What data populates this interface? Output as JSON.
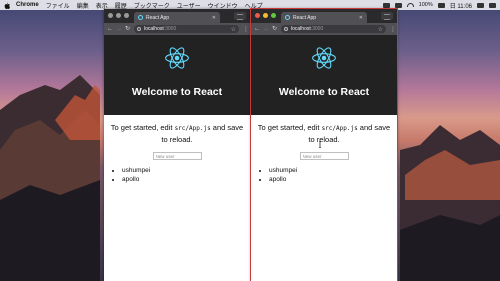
{
  "menubar": {
    "app_name": "Chrome",
    "items": [
      "ファイル",
      "編集",
      "表示",
      "履歴",
      "ブックマーク",
      "ユーザー",
      "ウインドウ",
      "ヘルプ"
    ],
    "battery": "100%",
    "clock": "日 11:06"
  },
  "windows": [
    {
      "tab_title": "React App",
      "url_host": "localhost",
      "url_port": ":3000",
      "header_title": "Welcome to React",
      "intro_before": "To get started, edit ",
      "intro_code": "src/App.js",
      "intro_after": " and save to reload.",
      "input_placeholder": "New user",
      "users": [
        "ushumpei",
        "apollo"
      ]
    },
    {
      "tab_title": "React App",
      "url_host": "localhost",
      "url_port": ":3000",
      "header_title": "Welcome to React",
      "intro_before": "To get started, edit ",
      "intro_code": "src/App.js",
      "intro_after": " and save to reload.",
      "input_placeholder": "New user",
      "users": [
        "ushumpei",
        "apollo"
      ]
    }
  ],
  "colors": {
    "react_accent": "#61dafb",
    "header_bg": "#222222",
    "close_red": "#ee5a52",
    "minimize_yellow": "#f5bd2e",
    "zoom_green": "#5fc83d"
  },
  "icons": [
    "apple-icon",
    "react-logo-icon",
    "info-icon",
    "star-icon",
    "reload-icon",
    "back-icon",
    "forward-icon",
    "menu-dots-icon",
    "close-icon",
    "profile-icon",
    "mouse-cursor-icon"
  ]
}
